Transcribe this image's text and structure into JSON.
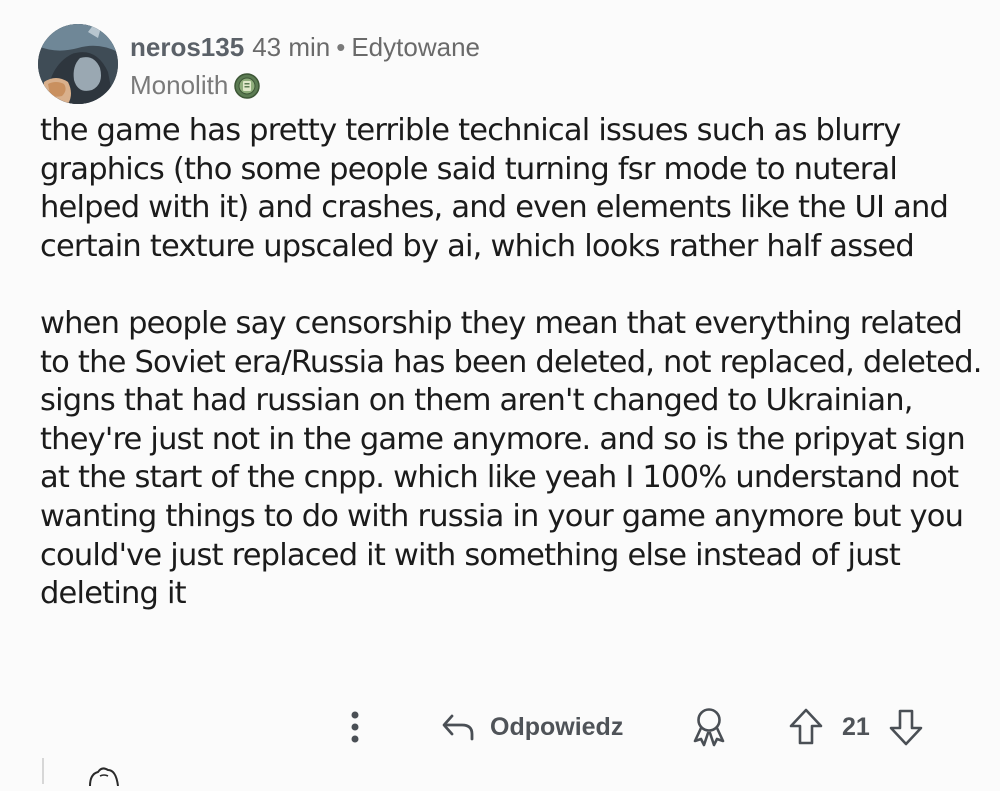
{
  "comment": {
    "username": "neros135",
    "time": "43 min",
    "separator": "•",
    "edited": "Edytowane",
    "flair": "Monolith",
    "paragraphs": [
      "the game has pretty terrible technical issues such as blurry graphics (tho some people said turning fsr mode to nuteral helped with it) and crashes, and even elements like the UI and certain texture upscaled by ai, which looks rather half assed",
      "when people say censorship they mean that everything related to the Soviet era/Russia has been deleted, not replaced, deleted. signs that had russian on them aren't changed to Ukrainian, they're just not in the game anymore. and so is the pripyat sign at the start of the cnpp. which like yeah I 100% understand not wanting things to do with russia in your game anymore but you could've just replaced it with something else instead of just deleting it"
    ]
  },
  "actions": {
    "more_icon": "more-vertical-icon",
    "reply_icon": "reply-arrow-icon",
    "reply_label": "Odpowiedz",
    "award_icon": "award-icon",
    "upvote_icon": "upvote-arrow-icon",
    "vote_count": "21",
    "downvote_icon": "downvote-arrow-icon"
  },
  "colors": {
    "background": "#fbfbfb",
    "text": "#1b1b1b",
    "muted": "#6a6a6a",
    "flair_badge": "#5b7b52"
  }
}
